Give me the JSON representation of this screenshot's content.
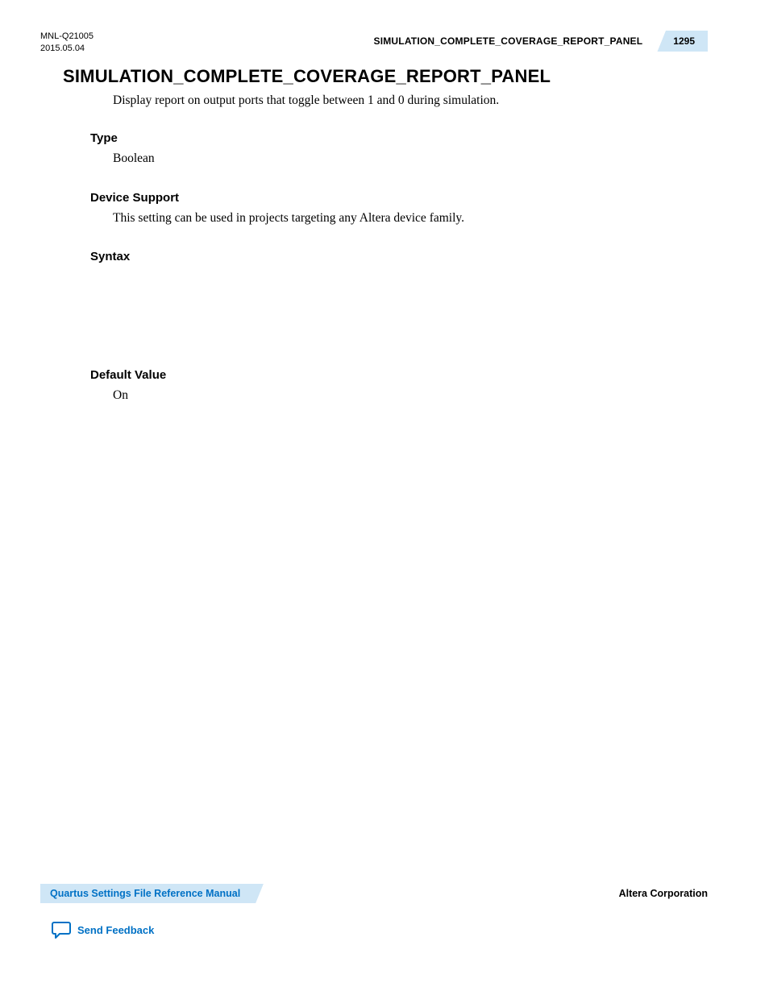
{
  "header": {
    "doc_id_line1": "MNL-Q21005",
    "doc_id_line2": "2015.05.04",
    "section_ref": "SIMULATION_COMPLETE_COVERAGE_REPORT_PANEL",
    "page_number": "1295"
  },
  "title": "SIMULATION_COMPLETE_COVERAGE_REPORT_PANEL",
  "intro": "Display report on output ports that toggle between 1 and 0 during simulation.",
  "sections": {
    "type": {
      "heading": "Type",
      "body": "Boolean"
    },
    "device_support": {
      "heading": "Device Support",
      "body": "This setting can be used in projects targeting any Altera device family."
    },
    "syntax": {
      "heading": "Syntax",
      "body": ""
    },
    "default_value": {
      "heading": "Default Value",
      "body": "On"
    }
  },
  "footer": {
    "manual_title": "Quartus Settings File Reference Manual",
    "company": "Altera Corporation",
    "feedback_label": "Send Feedback"
  }
}
